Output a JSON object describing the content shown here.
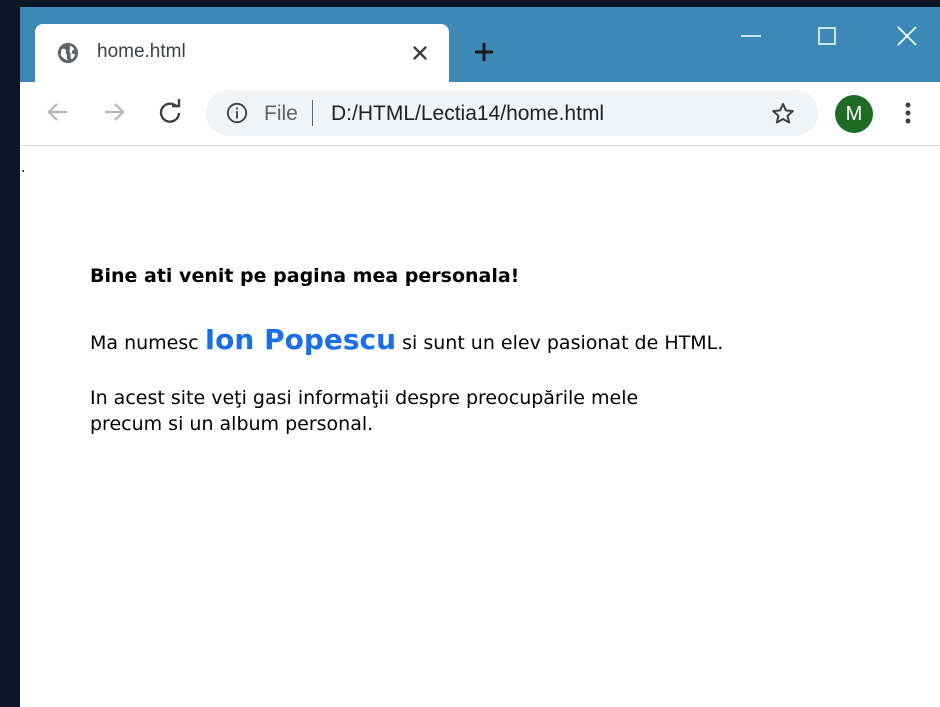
{
  "tab": {
    "title": "home.html",
    "favicon": "globe-icon"
  },
  "window_controls": {
    "minimize": "minimize-icon",
    "maximize": "maximize-icon",
    "close": "close-icon"
  },
  "toolbar": {
    "back": "arrow-left-icon",
    "forward": "arrow-right-icon",
    "reload": "reload-icon"
  },
  "omnibox": {
    "scheme_label": "File",
    "url": "D:/HTML/Lectia14/home.html"
  },
  "profile": {
    "initial": "M",
    "color": "#1e6c26"
  },
  "page": {
    "stray_mark": ".",
    "welcome": "Bine ati venit pe pagina mea personala!",
    "intro_before": "Ma numesc ",
    "name": "Ion Popescu",
    "intro_after": " si sunt un elev pasionat de HTML.",
    "description_line1": "In acest site veţi gasi informaţii despre preocupările mele",
    "description_line2": "precum si un album personal."
  },
  "colors": {
    "titlebar": "#3b8ab6",
    "name_accent": "#1a6fe6"
  }
}
